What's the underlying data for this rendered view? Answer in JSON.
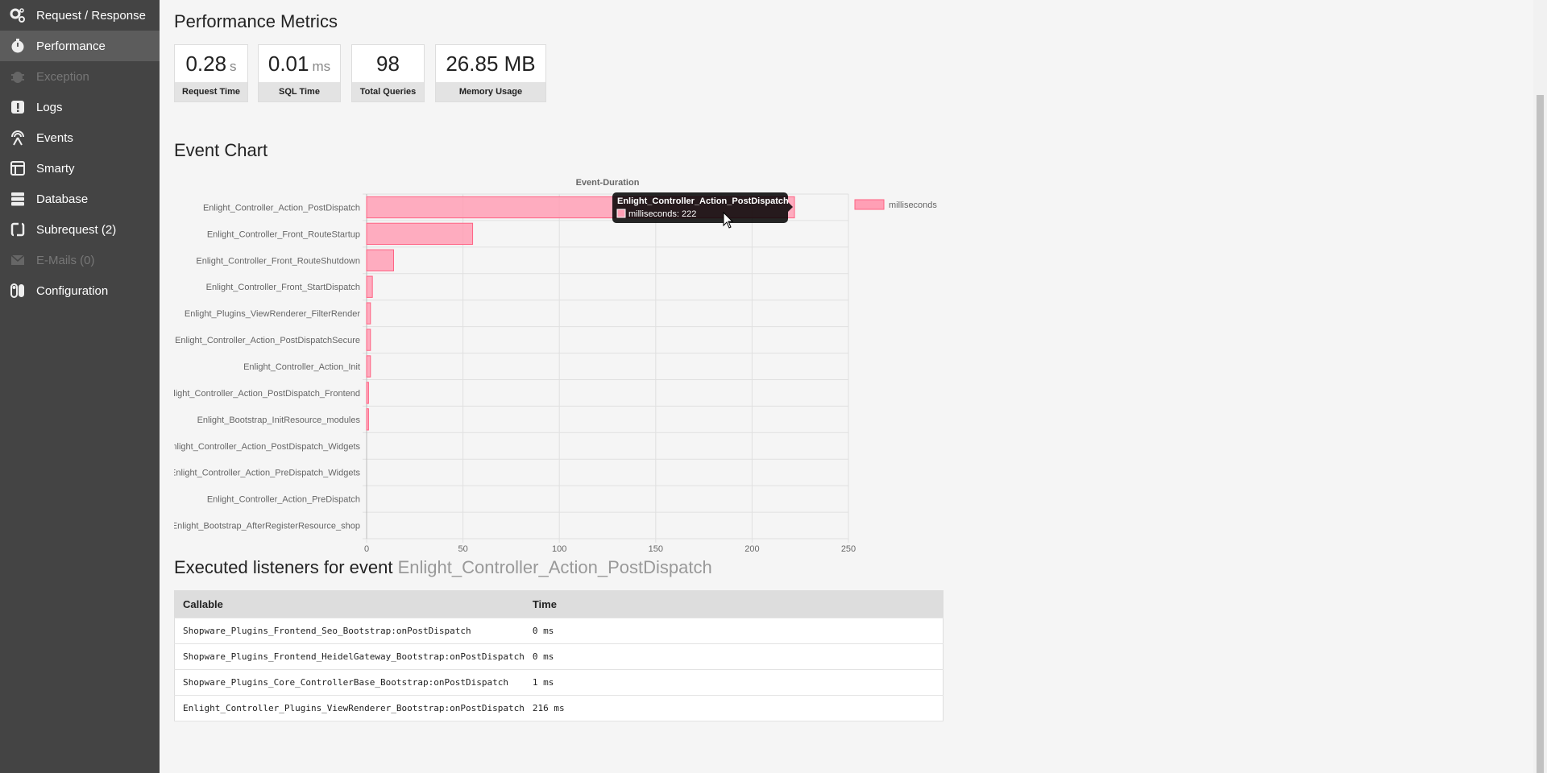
{
  "sidebar": {
    "items": [
      {
        "label": "Request / Response",
        "icon": "gears-icon",
        "state": "normal"
      },
      {
        "label": "Performance",
        "icon": "stopwatch-icon",
        "state": "active"
      },
      {
        "label": "Exception",
        "icon": "bug-icon",
        "state": "disabled"
      },
      {
        "label": "Logs",
        "icon": "exclamation-icon",
        "state": "normal"
      },
      {
        "label": "Events",
        "icon": "broadcast-icon",
        "state": "normal"
      },
      {
        "label": "Smarty",
        "icon": "layout-icon",
        "state": "normal"
      },
      {
        "label": "Database",
        "icon": "server-icon",
        "state": "normal"
      },
      {
        "label": "Subrequest (2)",
        "icon": "refresh-icon",
        "state": "normal"
      },
      {
        "label": "E-Mails (0)",
        "icon": "envelope-icon",
        "state": "disabled"
      },
      {
        "label": "Configuration",
        "icon": "toggles-icon",
        "state": "normal"
      }
    ]
  },
  "metrics": {
    "title": "Performance Metrics",
    "items": [
      {
        "value": "0.28",
        "unit": "s",
        "label": "Request Time"
      },
      {
        "value": "0.01",
        "unit": "ms",
        "label": "SQL Time"
      },
      {
        "value": "98",
        "unit": "",
        "label": "Total Queries"
      },
      {
        "value": "26.85 MB",
        "unit": "",
        "label": "Memory Usage"
      }
    ]
  },
  "event_chart": {
    "heading": "Event Chart"
  },
  "chart_data": {
    "type": "bar",
    "orientation": "horizontal",
    "title": "Event-Duration",
    "categories": [
      "Enlight_Controller_Action_PostDispatch",
      "Enlight_Controller_Front_RouteStartup",
      "Enlight_Controller_Front_RouteShutdown",
      "Enlight_Controller_Front_StartDispatch",
      "Enlight_Plugins_ViewRenderer_FilterRender",
      "Enlight_Controller_Action_PostDispatchSecure",
      "Enlight_Controller_Action_Init",
      "Enlight_Controller_Action_PostDispatch_Frontend",
      "Enlight_Bootstrap_InitResource_modules",
      "Enlight_Controller_Action_PostDispatch_Widgets",
      "Enlight_Controller_Action_PreDispatch_Widgets",
      "Enlight_Controller_Action_PreDispatch",
      "Enlight_Bootstrap_AfterRegisterResource_shop"
    ],
    "series": [
      {
        "name": "milliseconds",
        "values": [
          222,
          55,
          14,
          3,
          2,
          2,
          2,
          1,
          1,
          0,
          0,
          0,
          0
        ]
      }
    ],
    "xlim": [
      0,
      250
    ],
    "xticks": [
      0,
      50,
      100,
      150,
      200,
      250
    ],
    "grid": true,
    "legend": "top-right",
    "bar_color": "#ff9fb5",
    "bar_border": "#ff6384",
    "tooltip": {
      "title": "Enlight_Controller_Action_PostDispatch",
      "text": "milliseconds: 222"
    }
  },
  "listeners": {
    "heading_prefix": "Executed listeners for event",
    "heading_event": "Enlight_Controller_Action_PostDispatch",
    "columns": [
      "Callable",
      "Time"
    ],
    "rows": [
      {
        "callable": "Shopware_Plugins_Frontend_Seo_Bootstrap:onPostDispatch",
        "time": "0 ms"
      },
      {
        "callable": "Shopware_Plugins_Frontend_HeidelGateway_Bootstrap:onPostDispatch",
        "time": "0 ms"
      },
      {
        "callable": "Shopware_Plugins_Core_ControllerBase_Bootstrap:onPostDispatch",
        "time": "1 ms"
      },
      {
        "callable": "Enlight_Controller_Plugins_ViewRenderer_Bootstrap:onPostDispatch",
        "time": "216 ms"
      }
    ]
  }
}
